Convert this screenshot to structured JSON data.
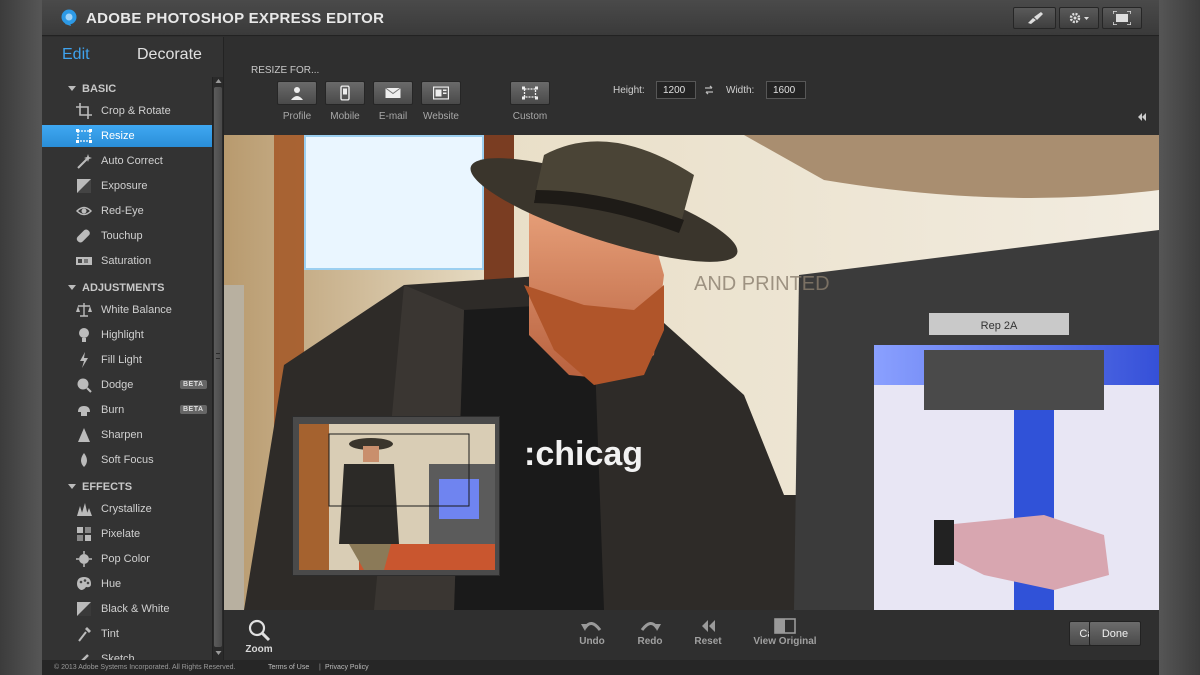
{
  "app": {
    "title": "ADOBE PHOTOSHOP EXPRESS EDITOR"
  },
  "toolbar": {
    "buttons": [
      {
        "icon": "brush-icon"
      },
      {
        "icon": "gear-icon"
      },
      {
        "icon": "fullscreen-icon"
      }
    ]
  },
  "mode_tabs": {
    "edit": "Edit",
    "decorate": "Decorate",
    "active": "Edit"
  },
  "sidebar": {
    "sections": [
      {
        "title": "BASIC",
        "tools": [
          {
            "label": "Crop & Rotate",
            "icon": "crop-icon"
          },
          {
            "label": "Resize",
            "icon": "resize-icon",
            "selected": true
          },
          {
            "label": "Auto Correct",
            "icon": "wand-icon"
          },
          {
            "label": "Exposure",
            "icon": "exposure-icon"
          },
          {
            "label": "Red-Eye",
            "icon": "eye-icon"
          },
          {
            "label": "Touchup",
            "icon": "bandage-icon"
          },
          {
            "label": "Saturation",
            "icon": "saturation-icon"
          }
        ]
      },
      {
        "title": "ADJUSTMENTS",
        "tools": [
          {
            "label": "White Balance",
            "icon": "scale-icon"
          },
          {
            "label": "Highlight",
            "icon": "bulb-icon"
          },
          {
            "label": "Fill Light",
            "icon": "bolt-icon"
          },
          {
            "label": "Dodge",
            "icon": "dodge-icon",
            "badge": "BETA"
          },
          {
            "label": "Burn",
            "icon": "burn-icon",
            "badge": "BETA"
          },
          {
            "label": "Sharpen",
            "icon": "sharpen-icon"
          },
          {
            "label": "Soft Focus",
            "icon": "drop-icon"
          }
        ]
      },
      {
        "title": "EFFECTS",
        "tools": [
          {
            "label": "Crystallize",
            "icon": "crystal-icon"
          },
          {
            "label": "Pixelate",
            "icon": "pixelate-icon"
          },
          {
            "label": "Pop Color",
            "icon": "popcolor-icon"
          },
          {
            "label": "Hue",
            "icon": "palette-icon"
          },
          {
            "label": "Black & White",
            "icon": "bw-icon"
          },
          {
            "label": "Tint",
            "icon": "dropper-icon"
          },
          {
            "label": "Sketch",
            "icon": "sketch-icon"
          }
        ]
      }
    ]
  },
  "resize": {
    "heading": "RESIZE FOR...",
    "presets": [
      {
        "label": "Profile",
        "icon": "person-icon"
      },
      {
        "label": "Mobile",
        "icon": "mobile-icon"
      },
      {
        "label": "E-mail",
        "icon": "envelope-icon"
      },
      {
        "label": "Website",
        "icon": "website-icon"
      }
    ],
    "custom": {
      "label": "Custom",
      "icon": "custom-icon"
    },
    "height_label": "Height:",
    "height_value": "1200",
    "width_label": "Width:",
    "width_value": "1600"
  },
  "canvas": {
    "photo_text": ":chicag",
    "machine_label": "Rep 2A",
    "sign_text": "AND PRINTED"
  },
  "bottom": {
    "zoom": "Zoom",
    "undo": "Undo",
    "redo": "Redo",
    "reset": "Reset",
    "view_original": "View Original",
    "cancel": "Cancel",
    "done": "Done"
  },
  "footer": {
    "copyright": "© 2013 Adobe Systems Incorporated. All Rights Reserved.",
    "terms": "Terms of Use",
    "separator": "|",
    "privacy": "Privacy Policy"
  },
  "colors": {
    "accent": "#3fa3ee",
    "selected_row": "#2f95e0",
    "panel": "#333333"
  }
}
